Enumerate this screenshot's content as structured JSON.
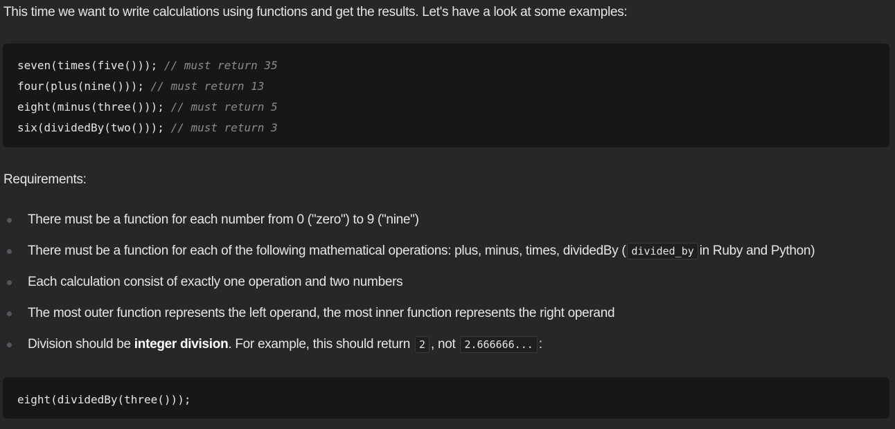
{
  "intro": "This time we want to write calculations using functions and get the results. Let's have a look at some examples:",
  "examples": [
    {
      "code": "seven(times(five()));",
      "comment": "// must return 35"
    },
    {
      "code": "four(plus(nine()));",
      "comment": "// must return 13"
    },
    {
      "code": "eight(minus(three()));",
      "comment": "// must return 5"
    },
    {
      "code": "six(dividedBy(two()));",
      "comment": "// must return 3"
    }
  ],
  "requirements_heading": "Requirements:",
  "requirements": {
    "r1": "There must be a function for each number from 0 (\"zero\") to 9 (\"nine\")",
    "r2_before": "There must be a function for each of the following mathematical operations: plus, minus, times, dividedBy (",
    "r2_code": "divided_by",
    "r2_after": "in Ruby and Python)",
    "r3": "Each calculation consist of exactly one operation and two numbers",
    "r4": "The most outer function represents the left operand, the most inner function represents the right operand",
    "r5_before": "Division should be ",
    "r5_bold": "integer division",
    "r5_middle": ". For example, this should return ",
    "r5_code1": "2",
    "r5_between": ", not ",
    "r5_code2": "2.666666...",
    "r5_after": ":"
  },
  "final_example": "eight(dividedBy(three()));"
}
